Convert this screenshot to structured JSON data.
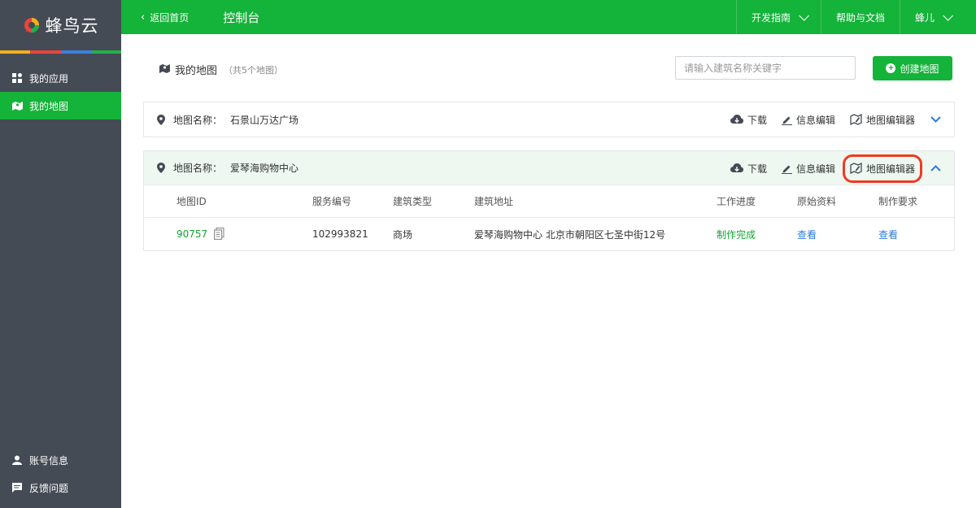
{
  "brand": {
    "name": "蜂鸟云",
    "stripe_colors": [
      "#f2b01c",
      "#e9453b",
      "#3d7fe0",
      "#21b14b"
    ]
  },
  "sidebar": {
    "items": [
      {
        "label": "我的应用",
        "icon": "grid-icon",
        "active": false
      },
      {
        "label": "我的地图",
        "icon": "map-icon",
        "active": true
      }
    ],
    "bottom_items": [
      {
        "label": "账号信息",
        "icon": "user-icon"
      },
      {
        "label": "反馈问题",
        "icon": "chat-icon"
      }
    ]
  },
  "topbar": {
    "back_label": "返回首页",
    "title": "控制台",
    "menus": [
      {
        "label": "开发指南",
        "has_caret": true
      },
      {
        "label": "帮助与文档",
        "has_caret": false
      },
      {
        "label": "蜂儿",
        "has_caret": true
      }
    ]
  },
  "page": {
    "title": "我的地图",
    "subtitle": "（共5个地图）",
    "search_placeholder": "请输入建筑名称关键字",
    "create_label": "创建地图"
  },
  "maps": [
    {
      "label": "地图名称：",
      "name": "石景山万达广场",
      "expanded": false,
      "actions": {
        "download": "下载",
        "edit_info": "信息编辑",
        "map_editor": "地图编辑器"
      }
    },
    {
      "label": "地图名称：",
      "name": "爱琴海购物中心",
      "expanded": true,
      "actions": {
        "download": "下载",
        "edit_info": "信息编辑",
        "map_editor": "地图编辑器"
      },
      "table": {
        "columns": [
          "地图ID",
          "服务编号",
          "建筑类型",
          "建筑地址",
          "工作进度",
          "原始资料",
          "制作要求"
        ],
        "row": {
          "map_id": "90757",
          "service_no": "102993821",
          "building_type": "商场",
          "address": "爱琴海购物中心 北京市朝阳区七圣中街12号",
          "progress": "制作完成",
          "raw_material": "查看",
          "requirements": "查看"
        }
      }
    }
  ],
  "colors": {
    "accent": "#14b339",
    "sidebar_bg": "#454b54",
    "link": "#2d7bd6",
    "highlight": "#ee3b22"
  }
}
